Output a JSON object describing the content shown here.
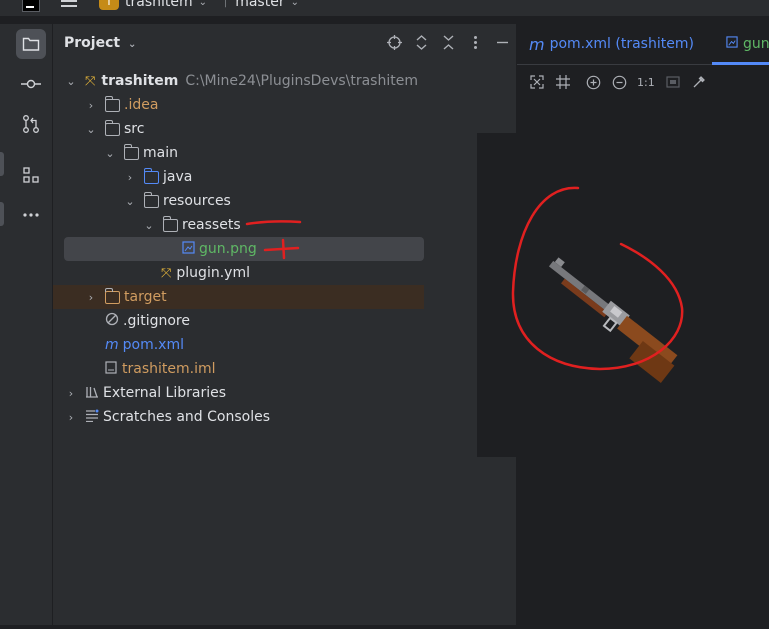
{
  "titlebar": {
    "project_badge": "T",
    "project_name": "trashitem",
    "branch": "master"
  },
  "leftbar": {
    "items": [
      {
        "name": "folder-icon",
        "active": true
      },
      {
        "name": "commit-icon"
      },
      {
        "name": "pull-requests-icon"
      },
      {
        "name": "structure-icon"
      },
      {
        "name": "more-icon"
      }
    ]
  },
  "project_panel": {
    "title": "Project",
    "tools": [
      "locate-icon",
      "expand-all-icon",
      "collapse-all-icon",
      "close-icon",
      "minimize-icon"
    ]
  },
  "tree": {
    "root": {
      "label": "trashitem",
      "path": "C:\\Mine24\\PluginsDevs\\trashitem"
    },
    "idea": ".idea",
    "src": "src",
    "main": "main",
    "java": "java",
    "resources": "resources",
    "reassets": "reassets",
    "gun": "gun.png",
    "plugin": "plugin.yml",
    "target": "target",
    "gitignore": ".gitignore",
    "pom": "pom.xml",
    "iml": "trashitem.iml",
    "external": "External Libraries",
    "scratches": "Scratches and Consoles"
  },
  "editor": {
    "tabs": [
      {
        "icon": "m",
        "label": "pom.xml (trashitem)"
      },
      {
        "label": "gun",
        "active": true
      }
    ],
    "zoom_label": "1:1"
  },
  "colors": {
    "accent": "#548af7",
    "annotation": "#e02020",
    "excluded_folder": "#d09c60",
    "new_file": "#5fb865"
  }
}
